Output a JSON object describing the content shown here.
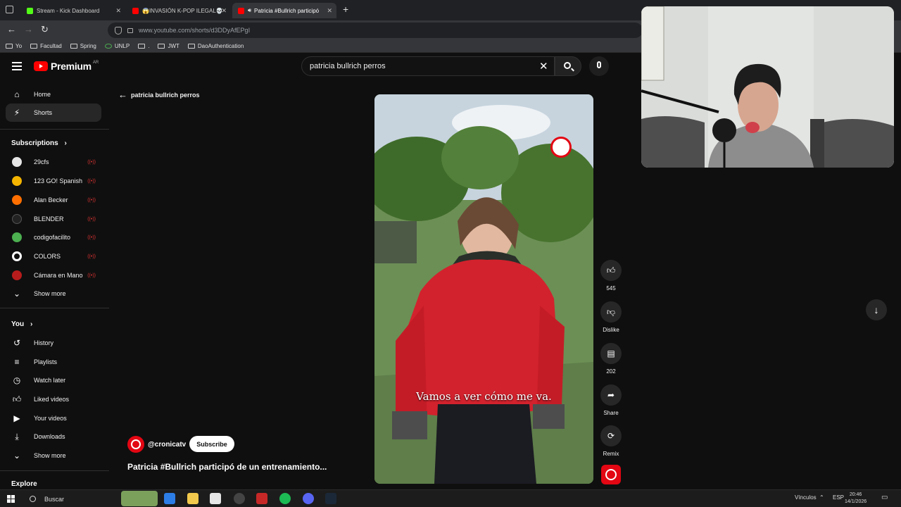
{
  "browser": {
    "tabs": [
      {
        "title": "Stream - Kick Dashboard",
        "color": "#53fc18"
      },
      {
        "title": "😱INVASIÓN K-POP ILEGAL💀",
        "color": "#ff0000"
      },
      {
        "title": "Patricia #Bullrich participó",
        "color": "#ff0000"
      }
    ],
    "url": "www.youtube.com/shorts/d3DDyAfEPgI",
    "bookmarks": [
      "Yo",
      "Facultad",
      "Spring",
      "UNLP",
      ".",
      "JWT",
      "DaoAuthentication"
    ]
  },
  "youtube": {
    "logo_text": "Premium",
    "country": "AR",
    "search_value": "patricia bullrich perros",
    "back_label": "patricia bullrich perros"
  },
  "sidebar": {
    "main": [
      {
        "label": "Home",
        "icon": "home-icon"
      },
      {
        "label": "Shorts",
        "icon": "shorts-icon"
      }
    ],
    "subscriptions_title": "Subscriptions",
    "subscriptions": [
      {
        "label": "29cfs",
        "color": "#e6e6e6"
      },
      {
        "label": "123 GO! Spanish",
        "color": "#f4b400"
      },
      {
        "label": "Alan Becker",
        "color": "#ff6f00"
      },
      {
        "label": "BLENDER",
        "color": "#111111"
      },
      {
        "label": "codigofacilito",
        "color": "#4caf50"
      },
      {
        "label": "COLORS",
        "color": "#ffffff"
      },
      {
        "label": "Cámara en Mano",
        "color": "#b71c1c"
      }
    ],
    "show_more": "Show more",
    "you_title": "You",
    "you_items": [
      {
        "label": "History",
        "icon": "history-icon"
      },
      {
        "label": "Playlists",
        "icon": "playlists-icon"
      },
      {
        "label": "Watch later",
        "icon": "watch-later-icon"
      },
      {
        "label": "Liked videos",
        "icon": "liked-icon"
      },
      {
        "label": "Your videos",
        "icon": "your-videos-icon"
      },
      {
        "label": "Downloads",
        "icon": "downloads-icon"
      }
    ],
    "show_more_2": "Show more",
    "explore_title": "Explore"
  },
  "short": {
    "caption": "Vamos a ver cómo me va.",
    "channel": "@cronicatv",
    "subscribe": "Subscribe",
    "title": "Patricia #Bullrich participó de un entrenamiento...",
    "likes": "545",
    "dislike_label": "Dislike",
    "comments": "202",
    "share_label": "Share",
    "remix_label": "Remix"
  },
  "taskbar": {
    "search_placeholder": "Buscar",
    "vinculos": "Vínculos",
    "lang": "ESP",
    "time": "20:46",
    "date": "14/1/2026"
  }
}
